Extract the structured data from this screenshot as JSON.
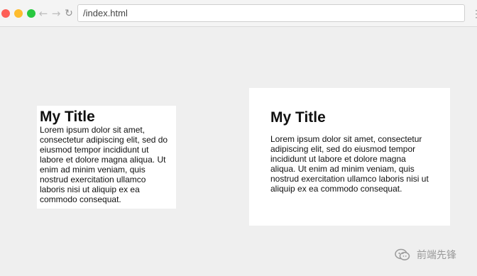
{
  "browser": {
    "url": "/index.html",
    "back_icon": "back-arrow-icon",
    "forward_icon": "forward-arrow-icon",
    "reload_icon": "reload-icon",
    "menu_icon": "kebab-menu-icon"
  },
  "cards": [
    {
      "title": "My Title",
      "body": "Lorem ipsum dolor sit amet, consectetur adipiscing elit, sed do eiusmod tempor incididunt ut labore et dolore magna aliqua. Ut enim ad minim veniam, quis nostrud exercitation ullamco laboris nisi ut aliquip ex ea commodo consequat."
    },
    {
      "title": "My Title",
      "body": "Lorem ipsum dolor sit amet, consectetur adipiscing elit, sed do eiusmod tempor incididunt ut labore et dolore magna aliqua. Ut enim ad minim veniam, quis nostrud exercitation ullamco laboris nisi ut aliquip ex ea commodo consequat."
    }
  ],
  "watermark": {
    "text": "前端先锋",
    "icon": "wechat-icon"
  }
}
